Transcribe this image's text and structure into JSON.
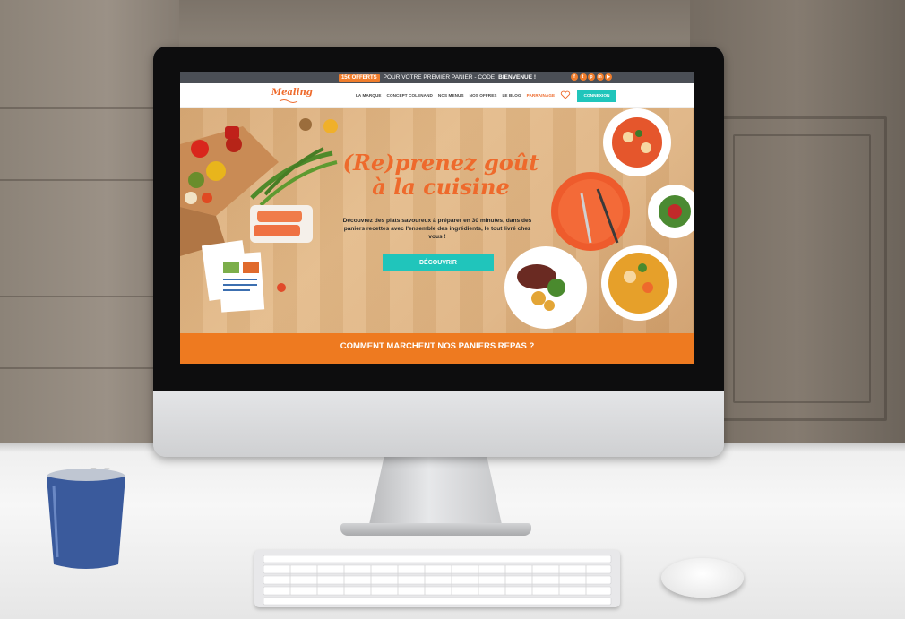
{
  "promo": {
    "badge": "15€ OFFERTS",
    "text": "POUR VOTRE PREMIER PANIER - CODE",
    "code": "BIENVENUE !"
  },
  "socials": [
    {
      "icon": "facebook-icon",
      "glyph": "f"
    },
    {
      "icon": "twitter-icon",
      "glyph": "t"
    },
    {
      "icon": "pinterest-icon",
      "glyph": "p"
    },
    {
      "icon": "linkedin-icon",
      "glyph": "in"
    },
    {
      "icon": "youtube-icon",
      "glyph": "▶"
    }
  ],
  "header": {
    "logo": "Mealing",
    "nav": [
      "LA MARQUE",
      "CONCEPT COLENAND",
      "NOS MENUS",
      "NOS OFFRES",
      "LE BLOG",
      "PARRAINAGE"
    ],
    "login": "CONNEXION"
  },
  "hero": {
    "title_line1": "(Re)prenez goût",
    "title_line2": "à la cuisine",
    "subtitle": "Découvrez des plats savoureux à préparer en 30 minutes, dans des paniers recettes avec l'ensemble des ingrédients, le tout livré chez vous !",
    "cta": "DÉCOUVRIR"
  },
  "how": {
    "title": "COMMENT MARCHENT NOS PANIERS REPAS ?"
  },
  "colors": {
    "brand_orange": "#ee6a2c",
    "teal": "#20c5bb",
    "band_orange": "#ee7a20",
    "promo_bar": "#4b4f56"
  }
}
